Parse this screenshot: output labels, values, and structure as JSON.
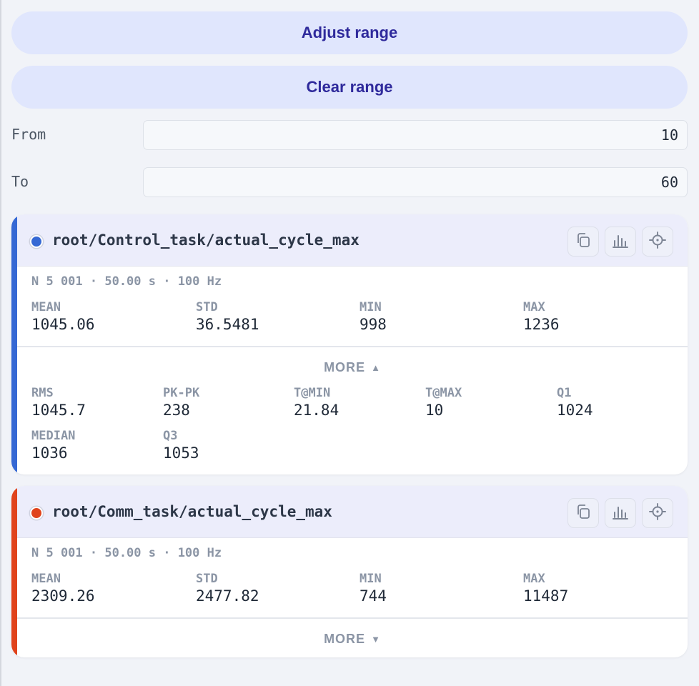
{
  "range": {
    "adjust_label": "Adjust range",
    "clear_label": "Clear range",
    "from_label": "From",
    "from_value": "10",
    "to_label": "To",
    "to_value": "60"
  },
  "cards": [
    {
      "name": "root/Control_task/actual_cycle_max",
      "color": "#3568d4",
      "meta": "N 5 001 · 50.00 s · 100 Hz",
      "primary": [
        {
          "label": "MEAN",
          "value": "1045.06"
        },
        {
          "label": "STD",
          "value": "36.5481"
        },
        {
          "label": "MIN",
          "value": "998"
        },
        {
          "label": "MAX",
          "value": "1236"
        }
      ],
      "more_label": "MORE",
      "more_arrow": "▲",
      "expanded": true,
      "extra": [
        {
          "label": "RMS",
          "value": "1045.7"
        },
        {
          "label": "PK-PK",
          "value": "238"
        },
        {
          "label": "T@MIN",
          "value": "21.84"
        },
        {
          "label": "T@MAX",
          "value": "10"
        },
        {
          "label": "Q1",
          "value": "1024"
        },
        {
          "label": "MEDIAN",
          "value": "1036"
        },
        {
          "label": "Q3",
          "value": "1053"
        }
      ]
    },
    {
      "name": "root/Comm_task/actual_cycle_max",
      "color": "#e0431c",
      "meta": "N 5 001 · 50.00 s · 100 Hz",
      "primary": [
        {
          "label": "MEAN",
          "value": "2309.26"
        },
        {
          "label": "STD",
          "value": "2477.82"
        },
        {
          "label": "MIN",
          "value": "744"
        },
        {
          "label": "MAX",
          "value": "11487"
        }
      ],
      "more_label": "MORE",
      "more_arrow": "▼",
      "expanded": false,
      "extra": []
    }
  ],
  "icons": {
    "copy": "copy-icon",
    "histogram": "histogram-icon",
    "locate": "crosshair-icon",
    "icon_color": "#7c8494"
  }
}
